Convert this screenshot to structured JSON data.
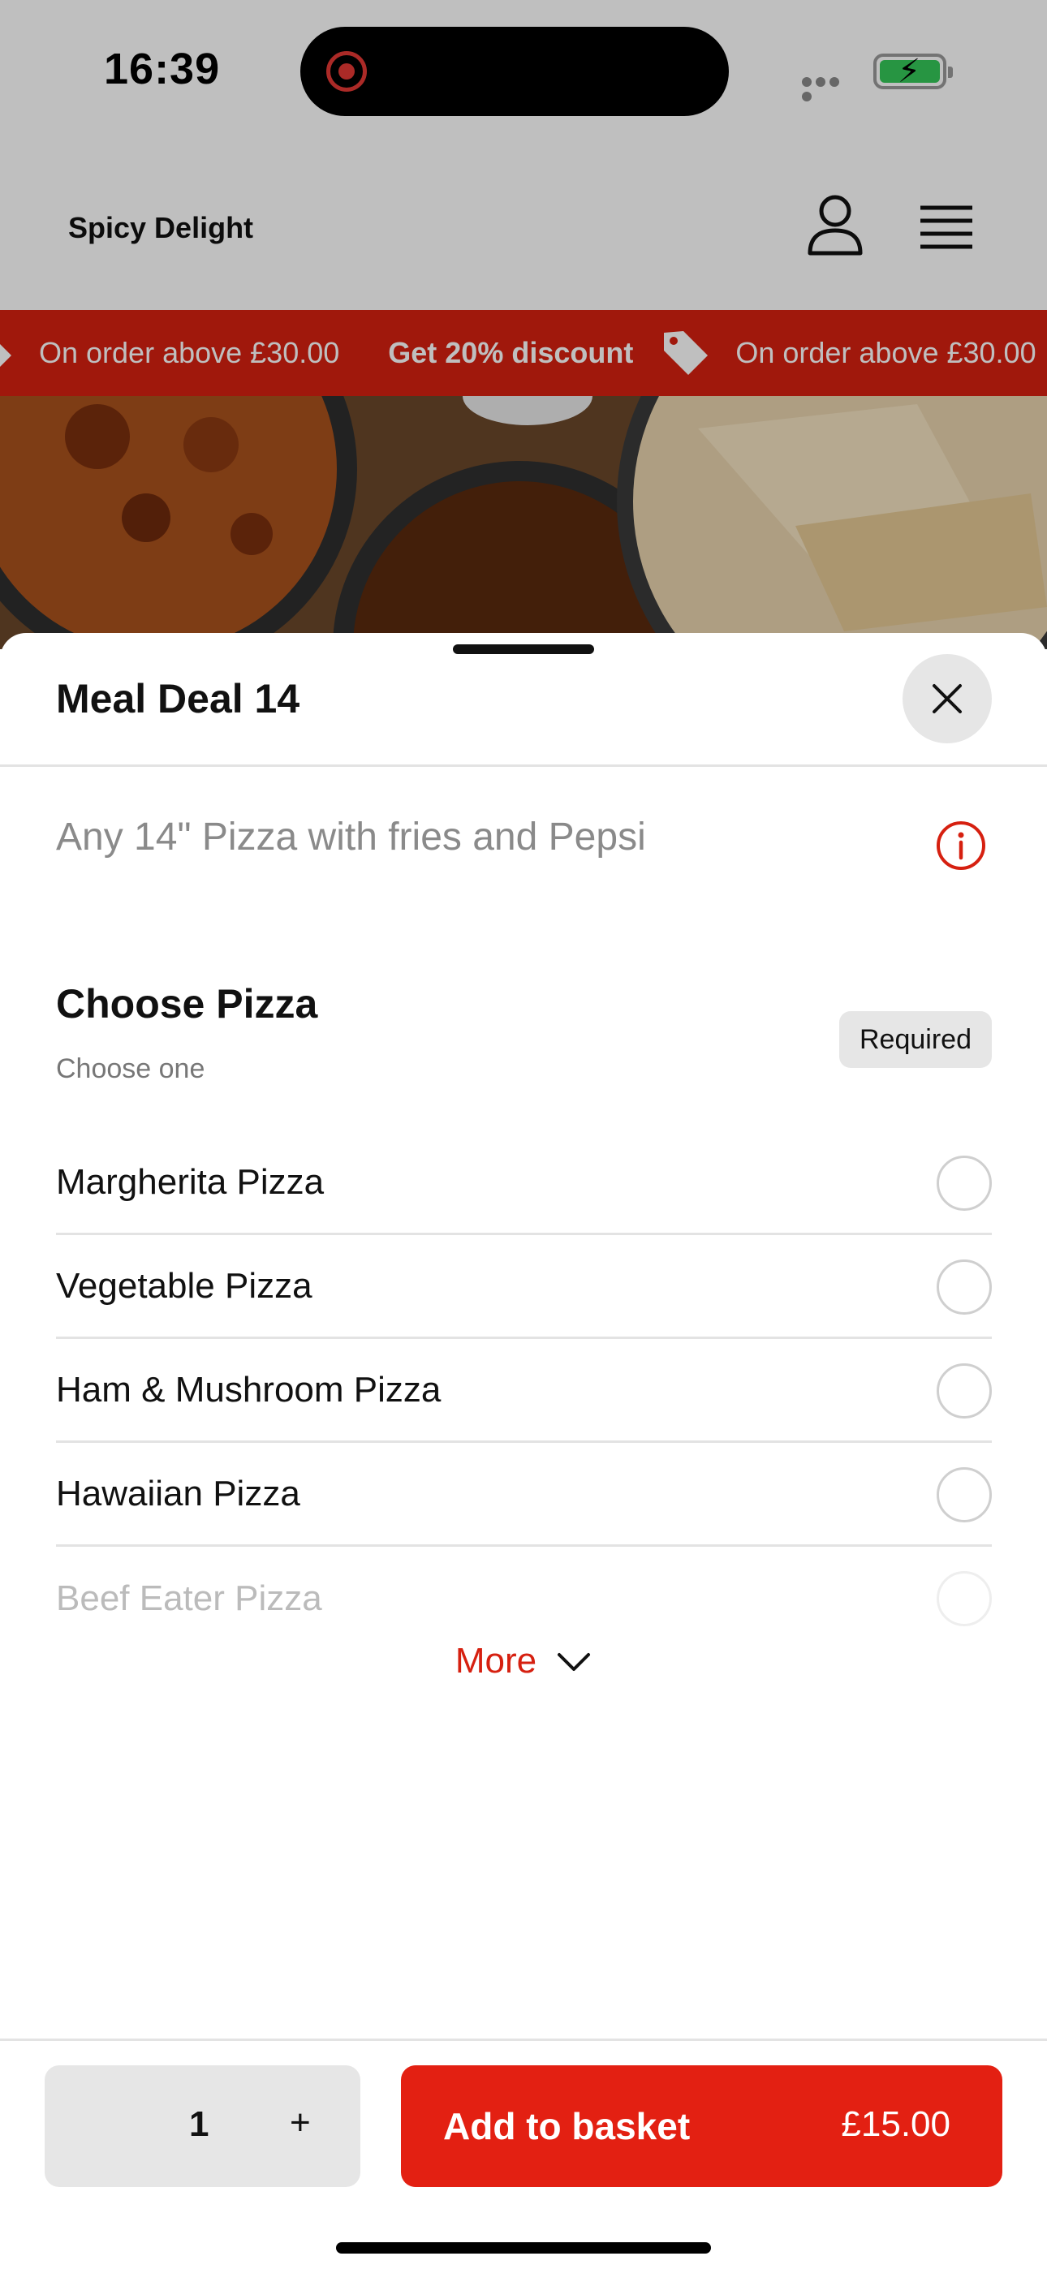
{
  "status_bar": {
    "time": "16:39"
  },
  "header": {
    "brand": "Spicy Delight"
  },
  "promo": {
    "items": [
      {
        "bold": "Get 20% discount",
        "text": "On order above £30.00"
      },
      {
        "bold": "Get 20% discount",
        "text": "On order above £30.00"
      }
    ]
  },
  "sheet": {
    "title": "Meal Deal 14",
    "description": "Any 14\" Pizza with fries and Pepsi",
    "section": {
      "title": "Choose Pizza",
      "subtitle": "Choose one",
      "badge": "Required",
      "options": [
        "Margherita Pizza",
        "Vegetable Pizza",
        "Ham & Mushroom Pizza",
        "Hawaiian Pizza",
        "Beef Eater Pizza"
      ],
      "more_label": "More"
    }
  },
  "bottom_bar": {
    "quantity": "1",
    "plus": "+",
    "add_label": "Add to basket",
    "price": "£15.00"
  },
  "colors": {
    "accent": "#d62010",
    "button": "#e32012"
  }
}
